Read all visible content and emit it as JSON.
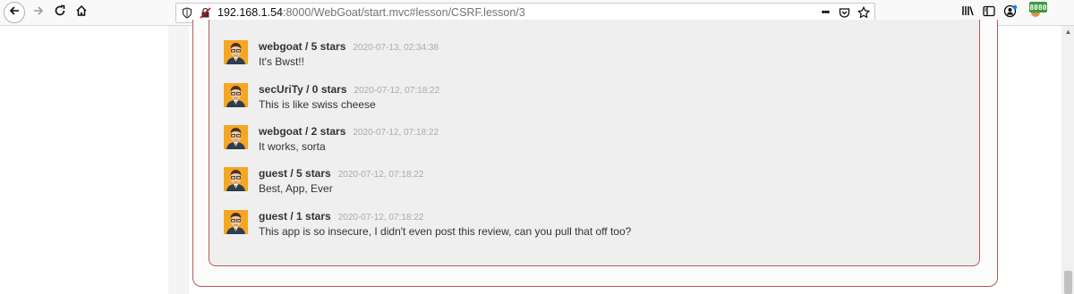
{
  "browser": {
    "url_host": "192.168.1.54",
    "url_rest": ":8000/WebGoat/start.mvc#lesson/CSRF.lesson/3",
    "more_label": "•••",
    "extension_badge": "8080",
    "icons": [
      "back-icon",
      "forward-icon",
      "reload-icon",
      "home-icon",
      "shield-icon",
      "insecure-lock-icon",
      "pocket-icon",
      "bookmark-star-icon",
      "library-icon",
      "sidebar-icon",
      "account-icon",
      "extension-icon"
    ]
  },
  "reviews": [
    {
      "user": "webgoat / 5 stars",
      "date": "2020-07-13, 02:34:38",
      "text": "It's Bwst!!"
    },
    {
      "user": "secUriTy / 0 stars",
      "date": "2020-07-12, 07:18:22",
      "text": "This is like swiss cheese"
    },
    {
      "user": "webgoat / 2 stars",
      "date": "2020-07-12, 07:18:22",
      "text": "It works, sorta"
    },
    {
      "user": "guest / 5 stars",
      "date": "2020-07-12, 07:18:22",
      "text": "Best, App, Ever"
    },
    {
      "user": "guest / 1 stars",
      "date": "2020-07-12, 07:18:22",
      "text": "This app is so insecure, I didn't even post this review, can you pull that off too?"
    }
  ],
  "colors": {
    "panel_border": "#b55a5a",
    "panel_bg": "#efefef",
    "avatar_bg": "#f5a623"
  }
}
